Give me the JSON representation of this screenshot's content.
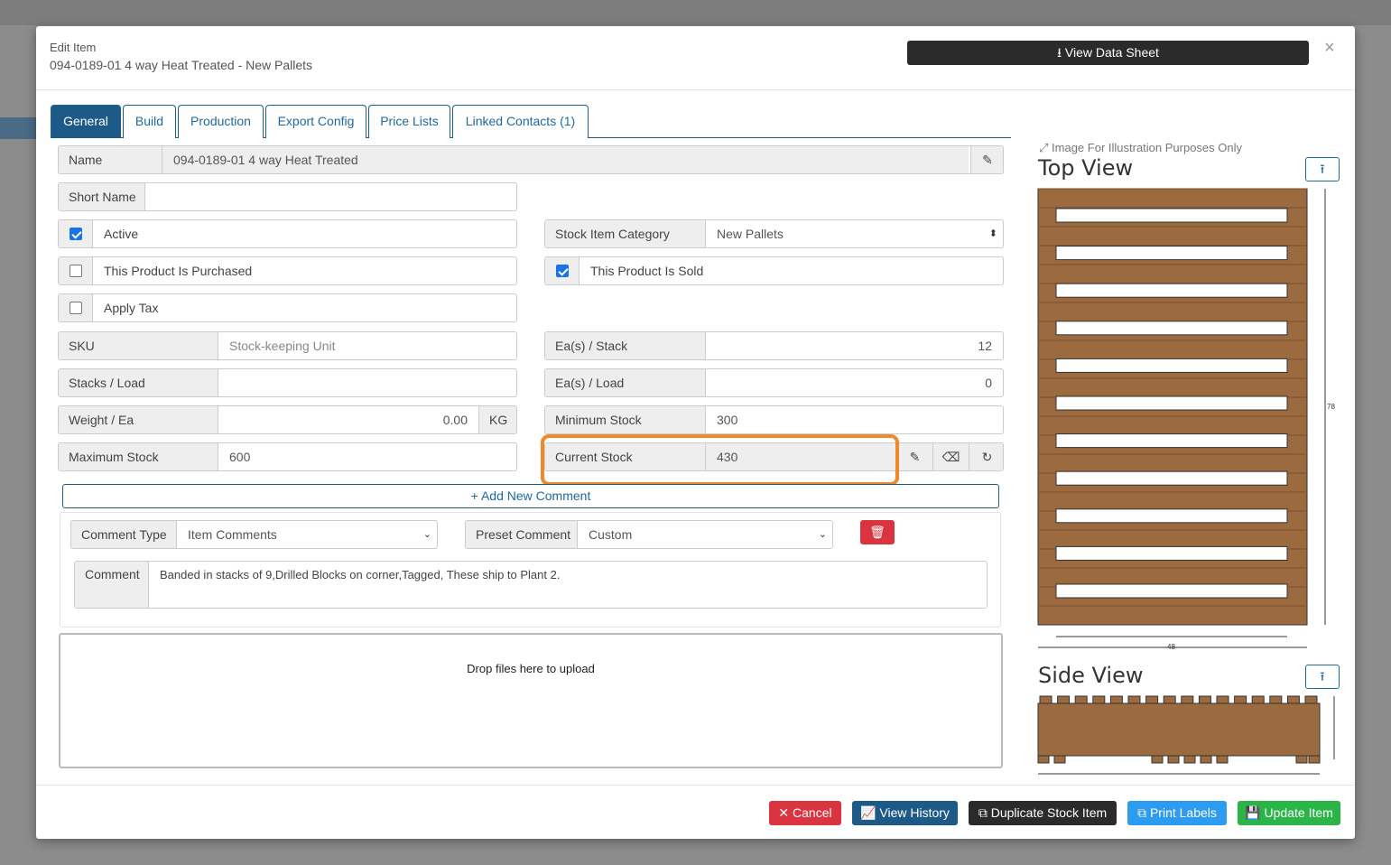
{
  "modal": {
    "subtitle": "Edit Item",
    "title": "094-0189-01 4 way Heat Treated - New Pallets",
    "datasheet_label": "View Data Sheet",
    "close_glyph": "×"
  },
  "tabs": [
    {
      "label": "General",
      "active": true
    },
    {
      "label": "Build"
    },
    {
      "label": "Production"
    },
    {
      "label": "Export Config"
    },
    {
      "label": "Price Lists"
    },
    {
      "label": "Linked Contacts  (1)"
    }
  ],
  "form": {
    "name_label": "Name",
    "name_value": "094-0189-01 4 way Heat Treated",
    "short_name_label": "Short Name",
    "short_name_value": "",
    "active_label": "Active",
    "active_checked": true,
    "purchased_label": "This Product Is Purchased",
    "purchased_checked": false,
    "apply_tax_label": "Apply Tax",
    "apply_tax_checked": false,
    "category_label": "Stock Item Category",
    "category_value": "New Pallets",
    "sold_label": "This Product Is Sold",
    "sold_checked": true,
    "sku_label": "SKU",
    "sku_placeholder": "Stock-keeping Unit",
    "stacks_load_label": "Stacks / Load",
    "stacks_load_value": "",
    "weight_label": "Weight / Ea",
    "weight_value": "0.00",
    "weight_unit": "KG",
    "max_stock_label": "Maximum Stock",
    "max_stock_value": "600",
    "ea_stack_label": "Ea(s) / Stack",
    "ea_stack_value": "12",
    "ea_load_label": "Ea(s) / Load",
    "ea_load_value": "0",
    "min_stock_label": "Minimum Stock",
    "min_stock_value": "300",
    "current_stock_label": "Current Stock",
    "current_stock_value": "430"
  },
  "comments": {
    "add_label": "+ Add New Comment",
    "type_label": "Comment Type",
    "type_value": "Item Comments",
    "preset_label": "Preset Comment",
    "preset_value": "Custom",
    "comment_label": "Comment",
    "comment_value": "Banded in stacks of 9,Drilled Blocks on corner,Tagged, These ship to Plant 2."
  },
  "upload": {
    "drop_text": "Drop files here to upload"
  },
  "preview": {
    "illustration_note": "Image For Illustration Purposes Only",
    "top_view_title": "Top View",
    "side_view_title": "Side View",
    "top_dim_length": "78",
    "top_dim_width": "48"
  },
  "footer": {
    "cancel": "✕ Cancel",
    "history": "View History",
    "duplicate": "Duplicate Stock Item",
    "print": "Print Labels",
    "update": "Update Item"
  },
  "colors": {
    "tab_active": "#1e5a87",
    "highlight": "#ef8a2c",
    "cancel": "#d9343f",
    "history": "#1e5a87",
    "duplicate": "#2b2b2b",
    "print": "#2d9cf0",
    "update": "#2bb548",
    "wood": "#9b6a3f"
  }
}
